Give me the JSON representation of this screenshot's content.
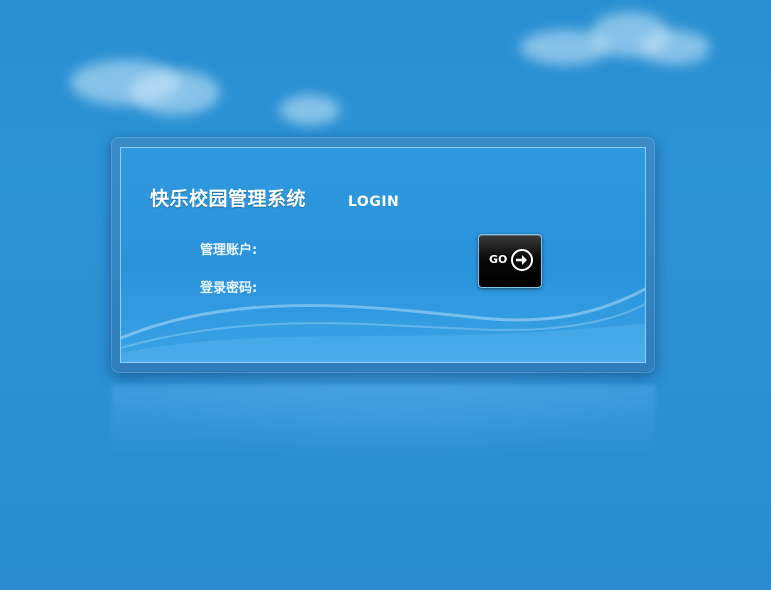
{
  "app": {
    "title": "快乐校园管理系统",
    "login_tag": "LOGIN"
  },
  "form": {
    "account_label": "管理账户:",
    "account_value": "",
    "password_label": "登录密码:",
    "password_value": ""
  },
  "actions": {
    "go_label": "GO",
    "go_icon": "arrow-right-circle-icon"
  },
  "colors": {
    "background": "#2c90d3",
    "panel": "#2f99df",
    "button": "#000000"
  }
}
